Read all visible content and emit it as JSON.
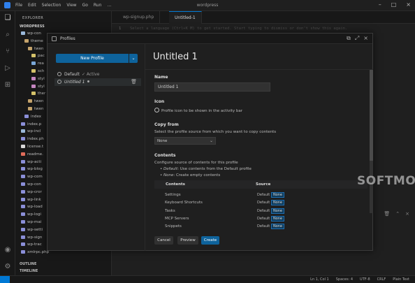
{
  "window": {
    "title": "wordpress",
    "menu": [
      "File",
      "Edit",
      "Selection",
      "View",
      "Go",
      "Run",
      "…"
    ]
  },
  "sidebar": {
    "header": "EXPLORER",
    "folder": "WORDPRESS",
    "items": [
      {
        "label": "wp-con",
        "indent": 0,
        "color": "#9ab8d9"
      },
      {
        "label": "theme",
        "indent": 1,
        "color": "#c5a36b"
      },
      {
        "label": "twen",
        "indent": 2,
        "color": "#c5a36b"
      },
      {
        "label": "pac",
        "indent": 3,
        "color": "#d4c26a"
      },
      {
        "label": "rea",
        "indent": 3,
        "color": "#7aa7d6"
      },
      {
        "label": "sch",
        "indent": 3,
        "color": "#d4c26a"
      },
      {
        "label": "styl",
        "indent": 3,
        "color": "#c586c0"
      },
      {
        "label": "styl",
        "indent": 3,
        "color": "#c586c0"
      },
      {
        "label": "ther",
        "indent": 3,
        "color": "#d4c26a"
      },
      {
        "label": "twen",
        "indent": 2,
        "color": "#c5a36b"
      },
      {
        "label": "twen",
        "indent": 2,
        "color": "#c5a36b"
      },
      {
        "label": "index",
        "indent": 1,
        "color": "#8b8fd8"
      },
      {
        "label": "index.p",
        "indent": 0,
        "color": "#8b8fd8"
      },
      {
        "label": "wp-incl",
        "indent": 0,
        "color": "#9ab8d9"
      },
      {
        "label": "index.ph",
        "indent": 0,
        "color": "#8b8fd8"
      },
      {
        "label": "license.t",
        "indent": 0,
        "color": "#d9d9d9"
      },
      {
        "label": "readme.",
        "indent": 0,
        "color": "#e06c5a"
      },
      {
        "label": "wp-acti",
        "indent": 0,
        "color": "#8b8fd8"
      },
      {
        "label": "wp-blog",
        "indent": 0,
        "color": "#8b8fd8"
      },
      {
        "label": "wp-com",
        "indent": 0,
        "color": "#8b8fd8"
      },
      {
        "label": "wp-con",
        "indent": 0,
        "color": "#8b8fd8"
      },
      {
        "label": "wp-cror",
        "indent": 0,
        "color": "#8b8fd8"
      },
      {
        "label": "wp-link",
        "indent": 0,
        "color": "#8b8fd8"
      },
      {
        "label": "wp-load",
        "indent": 0,
        "color": "#8b8fd8"
      },
      {
        "label": "wp-logi",
        "indent": 0,
        "color": "#8b8fd8"
      },
      {
        "label": "wp-mai",
        "indent": 0,
        "color": "#8b8fd8"
      },
      {
        "label": "wp-setti",
        "indent": 0,
        "color": "#8b8fd8"
      },
      {
        "label": "wp-sign",
        "indent": 0,
        "color": "#8b8fd8"
      },
      {
        "label": "wp-trac",
        "indent": 0,
        "color": "#8b8fd8"
      },
      {
        "label": "xmlrpc.php",
        "indent": 0,
        "color": "#8b8fd8"
      }
    ],
    "outline": "OUTLINE",
    "timeline": "TIMELINE"
  },
  "editor": {
    "tabs": [
      {
        "label": "wp-signup.php",
        "active": false
      },
      {
        "label": "Untitled-1",
        "active": true
      }
    ],
    "line_number": "1",
    "code_hint": "Select a language (Ctrl+K M) to get started. Start typing to dismiss or don't show this again."
  },
  "statusbar": {
    "items": [
      "Ln 1, Col 1",
      "Spaces: 4",
      "UTF-8",
      "CRLF",
      "Plain Text"
    ]
  },
  "modal": {
    "title": "Profiles",
    "new_profile_label": "New Profile",
    "profiles": [
      {
        "name": "Default",
        "badge": "✓ Active",
        "selected": false
      },
      {
        "name": "Untitled 1",
        "badge": "",
        "selected": true
      }
    ],
    "profile_title": "Untitled 1",
    "name_label": "Name",
    "name_value": "Untitled 1",
    "icon_label": "Icon",
    "icon_desc": "Profile icon to be shown in the activity bar",
    "copy_label": "Copy from",
    "copy_desc": "Select the profile source from which you want to copy contents",
    "copy_value": "None",
    "contents_label": "Contents",
    "contents_desc": "Configure source of contents for this profile",
    "bullet_default_key": "Default",
    "bullet_default_text": ": Use contents from the Default profile",
    "bullet_none_key": "None",
    "bullet_none_text": ": Create empty contents",
    "table_headers": [
      "Contents",
      "Source"
    ],
    "rows": [
      {
        "name": "Settings",
        "opt1": "Default",
        "opt2": "None"
      },
      {
        "name": "Keyboard Shortcuts",
        "opt1": "Default",
        "opt2": "None"
      },
      {
        "name": "Tasks",
        "opt1": "Default",
        "opt2": "None"
      },
      {
        "name": "MCP Servers",
        "opt1": "Default",
        "opt2": "None"
      },
      {
        "name": "Snippets",
        "opt1": "Default",
        "opt2": "None"
      }
    ],
    "cancel_label": "Cancel",
    "preview_label": "Preview",
    "create_label": "Create"
  },
  "watermark": "SOFTMOLA",
  "colors": {
    "accent": "#0e639c",
    "tab_accent": "#0078d4",
    "background": "#1f1f1f"
  }
}
